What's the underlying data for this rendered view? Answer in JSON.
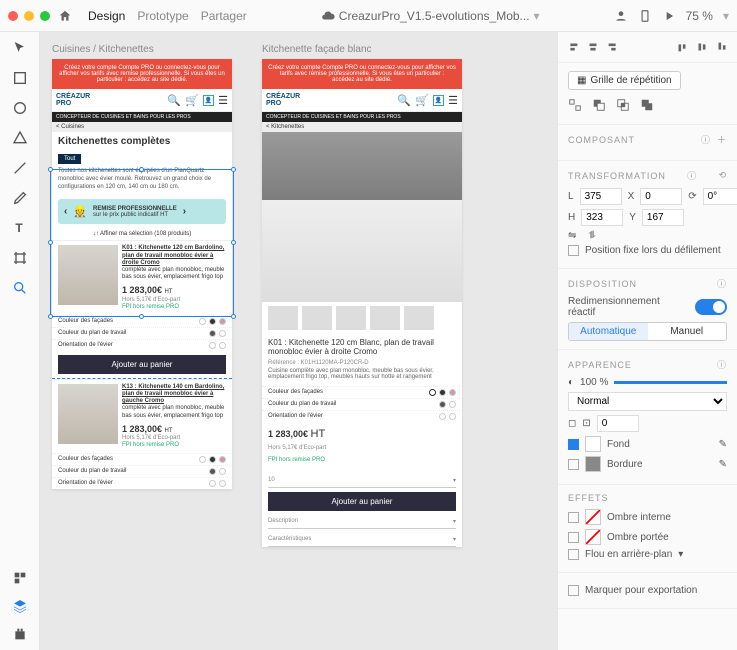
{
  "titlebar": {
    "tabs": [
      "Design",
      "Prototype",
      "Partager"
    ],
    "active_tab": 0,
    "filename": "CreazurPro_V1.5-evolutions_Mob...",
    "zoom": "75 %"
  },
  "artboards": {
    "a1_title": "Cuisines / Kitchenettes",
    "a2_title": "Kitchenette façade blanc"
  },
  "store": {
    "banner": "Créez votre compte Compte PRO ou connectez-vous pour afficher vos tarifs avec remise professionnelle. Si vous êtes un particulier : accédez au site dédié.",
    "logo_top": "CRÉAZUR",
    "logo_bottom": "PRO",
    "baseline": "CONCEPTEUR DE CUISINES ET BAINS POUR LES PROS",
    "crumb1": "< Cuisines",
    "crumb2": "< Kitchenettes",
    "heading": "Kitchenettes complètes",
    "chip_all": "Tout",
    "intro": "Toutes nos kitchenettes sont équipées d'un PlanQuartz monobloc avec évier moulé. Retrouvez un grand choix de configurations en 120 cm, 140 cm ou 180 cm.",
    "promo_label": "REMISE PROFESSIONNELLE",
    "promo_sub": "sur le prix public indicatif HT",
    "refine": "↓↑ Affiner ma sélection (108 produits)",
    "opt_facade": "Couleur des façades",
    "opt_plan": "Couleur du plan de travail",
    "opt_evier": "Orientation de l'évier",
    "cta": "Ajouter au panier",
    "p1_name": "K01 : Kitchenette 120 cm Bardolino, plan de travail monobloc évier à droite Cromo",
    "p1_desc": "complète avec plan monobloc, meuble bas sous évier, emplacement frigo top",
    "p1_price": "1 283,00€ ",
    "p1_ht": "HT",
    "p1_eco": "Hors 5,17€ d'Eco-part",
    "p1_badge": "FPI hors remise PRO",
    "p2_name": "K13 : Kitchenette 140 cm Bardolino, plan de travail monobloc évier à gauche Cromo",
    "detail_title": "K01 : Kitchenette 120 cm Blanc, plan de travail monobloc évier à droite Cromo",
    "detail_ref": "Référence : K01H1120MA-P120CR-D",
    "detail_desc": "Cuisine complète avec plan monobloc, meuble bas sous évier, emplacement frigo top, meubles hauts sur hotte et rangement",
    "qty": "10",
    "accordion1": "Description",
    "accordion2": "Caractéristiques"
  },
  "inspector": {
    "grid_repeat": "Grille de répétition",
    "composant": "COMPOSANT",
    "transformation": "TRANSFORMATION",
    "L": "L",
    "L_val": "375",
    "X": "X",
    "X_val": "0",
    "rot_val": "0°",
    "H": "H",
    "H_val": "323",
    "Y": "Y",
    "Y_val": "167",
    "lock_scroll": "Position fixe lors du défilement",
    "disposition": "DISPOSITION",
    "responsive": "Redimensionnement réactif",
    "auto": "Automatique",
    "manual": "Manuel",
    "apparence": "APPARENCE",
    "opacity": "100 %",
    "blend": "Normal",
    "radius": "0",
    "fond": "Fond",
    "bordure": "Bordure",
    "effets": "EFFETS",
    "ombre_int": "Ombre interne",
    "ombre_port": "Ombre portée",
    "flou": "Flou en arrière-plan",
    "export": "Marquer pour exportation"
  }
}
